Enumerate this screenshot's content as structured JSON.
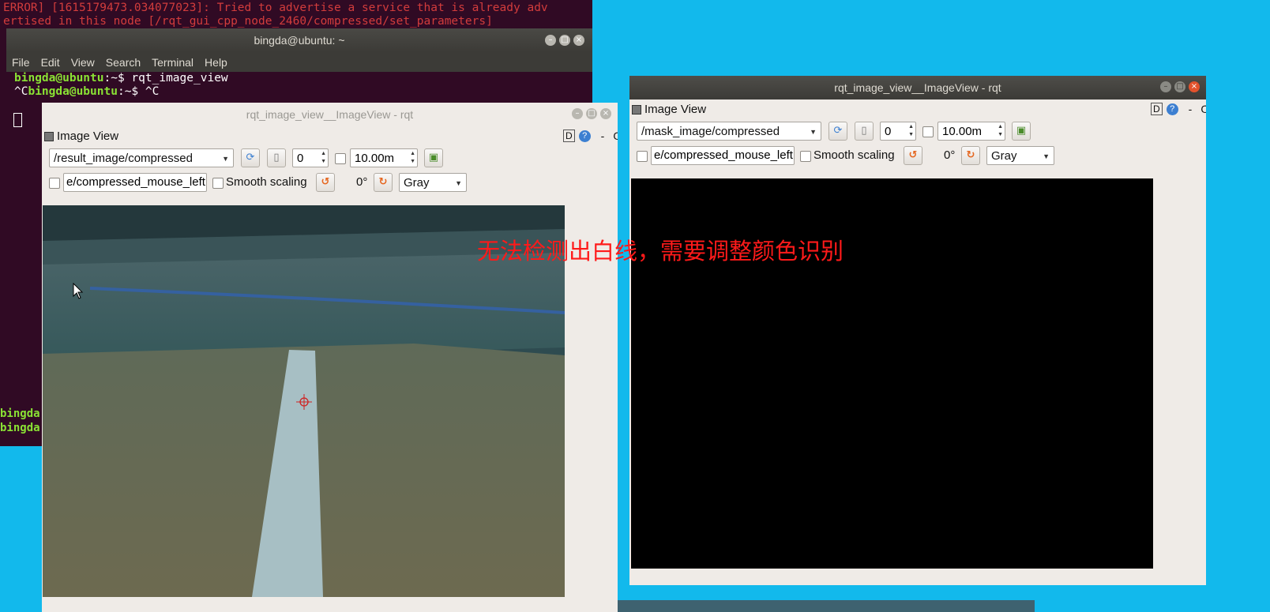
{
  "terminal": {
    "error_line_1": "ERROR] [1615179473.034077023]: Tried to advertise a service that is already adv",
    "error_line_2": "ertised in this node [/rqt_gui_cpp_node_2460/compressed/set_parameters]",
    "title": "bingda@ubuntu: ~",
    "menu": [
      "File",
      "Edit",
      "View",
      "Search",
      "Terminal",
      "Help"
    ],
    "line1_user": "bingda@ubuntu",
    "line1_path": ":~$",
    "line1_cmd": " rqt_image_view",
    "line2_prefix": "^C",
    "line2_user": "bingda@ubuntu",
    "line2_path": ":~$",
    "line2_cmd": " ^C",
    "bottom_prompt_1": "bingda",
    "bottom_prompt_2": "bingda"
  },
  "left_window": {
    "title": "rqt_image_view__ImageView - rqt",
    "panel_label": "Image View",
    "corner_d": "D",
    "corner_q": "?",
    "corner_dash": "-",
    "corner_o": "O",
    "topic": "/result_image/compressed",
    "spin_value": "0",
    "timeout": "10.00m",
    "mouse_topic": "e/compressed_mouse_left",
    "smooth_label": "Smooth scaling",
    "rotation": "0°",
    "colormap": "Gray"
  },
  "right_window": {
    "title": "rqt_image_view__ImageView - rqt",
    "panel_label": "Image View",
    "corner_d": "D",
    "corner_q": "?",
    "corner_dash": "-",
    "corner_o": "O",
    "topic": "/mask_image/compressed",
    "spin_value": "0",
    "timeout": "10.00m",
    "mouse_topic": "e/compressed_mouse_left",
    "smooth_label": "Smooth scaling",
    "rotation": "0°",
    "colormap": "Gray"
  },
  "annotation": "无法检测出白线，需要调整颜色识别",
  "icons": {
    "refresh": "refresh-icon",
    "pause": "pause-icon",
    "save": "save-image-icon",
    "rotate_left": "rotate-left-icon",
    "rotate_right": "rotate-right-icon"
  },
  "colors": {
    "desktop": "#12b9ec",
    "terminal_bg": "#300a24",
    "annotation": "#ff1a1a"
  }
}
